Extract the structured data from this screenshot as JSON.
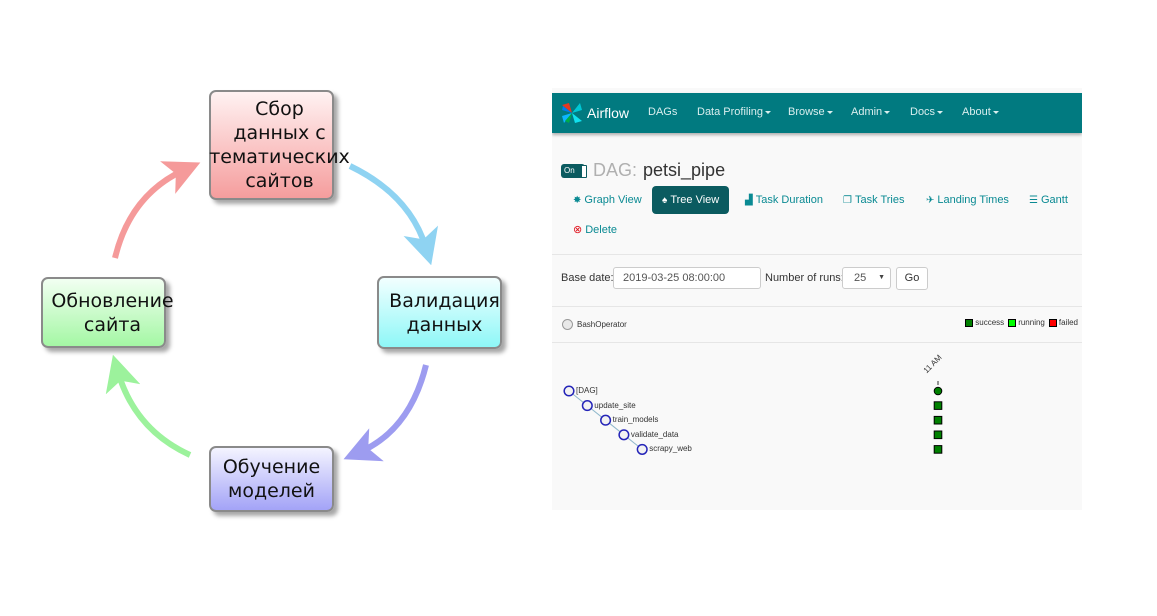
{
  "diagram": {
    "type": "cycle",
    "nodes": [
      {
        "id": "collect",
        "lines": [
          "Сбор",
          "данных с",
          "тематических",
          "сайтов"
        ],
        "color": "#f59d9d"
      },
      {
        "id": "validate",
        "lines": [
          "Валидация",
          "данных"
        ],
        "color": "#8ef7f7"
      },
      {
        "id": "train",
        "lines": [
          "Обучение",
          "моделей"
        ],
        "color": "#a3a3f7"
      },
      {
        "id": "update",
        "lines": [
          "Обновление",
          "сайта"
        ],
        "color": "#a4f7a4"
      }
    ],
    "edges": [
      {
        "from": "collect",
        "to": "validate",
        "color": "#8fd3f2"
      },
      {
        "from": "validate",
        "to": "train",
        "color": "#9d9cf0"
      },
      {
        "from": "train",
        "to": "update",
        "color": "#9cf29c"
      },
      {
        "from": "update",
        "to": "collect",
        "color": "#f59a9a"
      }
    ]
  },
  "airflow": {
    "brand": "Airflow",
    "nav": [
      {
        "label": "DAGs",
        "dropdown": false
      },
      {
        "label": "Data Profiling",
        "dropdown": true
      },
      {
        "label": "Browse",
        "dropdown": true
      },
      {
        "label": "Admin",
        "dropdown": true
      },
      {
        "label": "Docs",
        "dropdown": true
      },
      {
        "label": "About",
        "dropdown": true
      }
    ],
    "toggle_label": "On",
    "dag_prefix": "DAG:",
    "dag_name": "petsi_pipe",
    "tabs": [
      {
        "label": "Graph View",
        "icon": "asterisk-icon",
        "active": false
      },
      {
        "label": "Tree View",
        "icon": "tree-icon",
        "active": true
      },
      {
        "label": "Task Duration",
        "icon": "bar-chart-icon",
        "active": false
      },
      {
        "label": "Task Tries",
        "icon": "copy-icon",
        "active": false
      },
      {
        "label": "Landing Times",
        "icon": "plane-icon",
        "active": false
      },
      {
        "label": "Gantt",
        "icon": "align-left-icon",
        "active": false
      }
    ],
    "delete_label": "Delete",
    "base_date_label": "Base date:",
    "base_date_value": "2019-03-25 08:00:00",
    "runs_label": "Number of runs:",
    "runs_value": "25",
    "go_label": "Go",
    "operator": "BashOperator",
    "legend": [
      {
        "label": "success",
        "color": "#008000"
      },
      {
        "label": "running",
        "color": "#00ff00"
      },
      {
        "label": "failed",
        "color": "#ff0000"
      }
    ],
    "tree": {
      "time_label": "11 AM",
      "nodes": [
        {
          "label": "[DAG]",
          "status": "success"
        },
        {
          "label": "update_site",
          "status": "success"
        },
        {
          "label": "train_models",
          "status": "success"
        },
        {
          "label": "validate_data",
          "status": "success"
        },
        {
          "label": "scrapy_web",
          "status": "success"
        }
      ]
    },
    "colors": {
      "navbar": "#017a80",
      "accent": "#0b5b60",
      "link": "#0a8a93"
    }
  }
}
